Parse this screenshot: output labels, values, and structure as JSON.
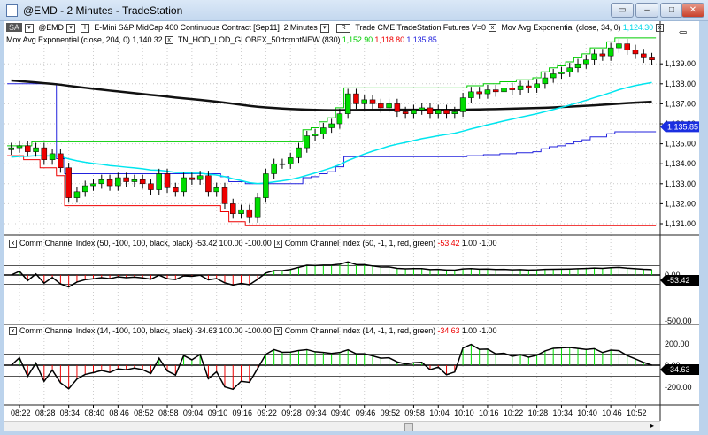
{
  "window": {
    "title": "@EMD - 2 Minutes - TradeStation"
  },
  "toolbar": {
    "sa": "SA",
    "symbol": "@EMD",
    "description": "E-Mini S&P MidCap 400 Continuous Contract [Sep11]",
    "interval": "2 Minutes",
    "r": "R",
    "exchange_info": "Trade  CME  TradeStation  Futures  V=0",
    "ema34_label": "Mov Avg Exponential  (close, 34, 0)",
    "ema34_value": "1,124.30"
  },
  "indicators": {
    "ema204_label": "Mov Avg Exponential  (close, 204, 0)",
    "ema204_value": "1,140.32",
    "hodlod_label": "TN_HOD_LOD_GLOBEX_50rtcmntNEW  (830)",
    "hod_value": "1,152.90",
    "lod_value": "1,118.80",
    "mid_value": "1,135.85"
  },
  "cci1": {
    "label1": "Comm Channel Index  (50, -100, 100, black, black)",
    "values1": "-53.42  100.00  -100.00",
    "label2": "Comm Channel Index  (50, -1, 1, red, green)",
    "value2": "-53.42",
    "values2b": "1.00  -1.00",
    "axis": [
      "0.00",
      "-500.00"
    ],
    "last": "-53.42"
  },
  "cci2": {
    "label1": "Comm Channel Index  (14, -100, 100, black, black)",
    "values1": "-34.63  100.00  -100.00",
    "label2": "Comm Channel Index  (14, -1, 1, red, green)",
    "value2": "-34.63",
    "values2b": "1.00  -1.00",
    "axis": [
      "200.00",
      "0.00",
      "-200.00"
    ],
    "last": "-34.63"
  },
  "price_axis": [
    "1,139.00",
    "1,138.00",
    "1,137.00",
    "1,136.00",
    "1,135.00",
    "1,134.00",
    "1,133.00",
    "1,132.00",
    "1,131.00"
  ],
  "last_price": "1,135.85",
  "time_axis": [
    "08:22",
    "08:28",
    "08:34",
    "08:40",
    "08:46",
    "08:52",
    "08:58",
    "09:04",
    "09:10",
    "09:16",
    "09:22",
    "09:28",
    "09:34",
    "09:40",
    "09:46",
    "09:52",
    "09:58",
    "10:04",
    "10:10",
    "10:16",
    "10:22",
    "10:28",
    "10:34",
    "10:40",
    "10:46",
    "10:52"
  ],
  "colors": {
    "up": "#00dd00",
    "down": "#ee0000",
    "ema34": "#00e5ee",
    "ema204": "#111111",
    "hod": "#00cc00",
    "lod": "#ee0000",
    "mid": "#2222dd"
  },
  "closes": [
    1134.8,
    1134.9,
    1134.6,
    1134.8,
    1134.2,
    1134.5,
    1133.8,
    1132.3,
    1132.6,
    1132.9,
    1133.0,
    1133.2,
    1132.9,
    1133.3,
    1133.1,
    1133.2,
    1133.0,
    1132.7,
    1133.5,
    1132.8,
    1132.6,
    1133.3,
    1133.2,
    1133.4,
    1132.6,
    1132.8,
    1132.0,
    1131.5,
    1131.7,
    1131.3,
    1132.3,
    1133.5,
    1134.0,
    1134.0,
    1134.3,
    1134.8,
    1135.4,
    1135.5,
    1135.8,
    1136.0,
    1136.5,
    1137.5,
    1137.0,
    1137.2,
    1137.0,
    1136.8,
    1137.0,
    1136.6,
    1136.5,
    1136.7,
    1136.8,
    1136.5,
    1136.7,
    1136.5,
    1136.6,
    1137.3,
    1137.6,
    1137.5,
    1137.7,
    1137.6,
    1137.8,
    1137.7,
    1137.9,
    1137.8,
    1138.0,
    1138.3,
    1138.5,
    1138.6,
    1138.8,
    1139.0,
    1139.2,
    1139.5,
    1139.4,
    1139.8,
    1140.0,
    1139.7,
    1139.5,
    1139.3,
    1139.2
  ]
}
